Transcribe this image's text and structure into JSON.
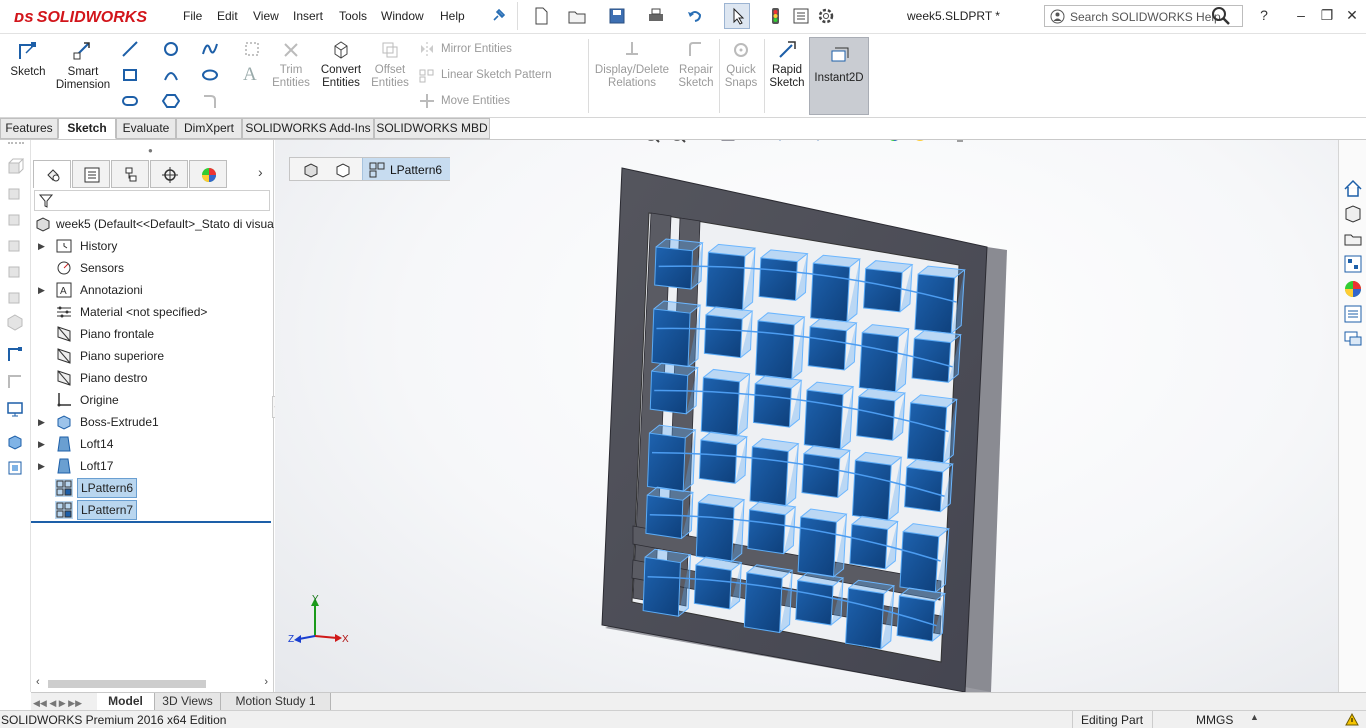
{
  "app": {
    "brand": "SOLIDWORKS",
    "document_title": "week5.SLDPRT *",
    "menu": [
      "File",
      "Edit",
      "View",
      "Insert",
      "Tools",
      "Window",
      "Help"
    ],
    "search_placeholder": "Search SOLIDWORKS Help"
  },
  "commands": {
    "sketch": "Sketch",
    "smart_dimension": "Smart Dimension",
    "trim_entities": "Trim Entities",
    "convert_entities": "Convert Entities",
    "offset_entities": "Offset Entities",
    "mirror_entities": "Mirror Entities",
    "linear_sketch_pattern": "Linear Sketch Pattern",
    "move_entities": "Move Entities",
    "display_delete_relations": "Display/Delete Relations",
    "repair_sketch": "Repair Sketch",
    "quick_snaps": "Quick Snaps",
    "rapid_sketch": "Rapid Sketch",
    "instant2d": "Instant2D"
  },
  "tabs": [
    "Features",
    "Sketch",
    "Evaluate",
    "DimXpert",
    "SOLIDWORKS Add-Ins",
    "SOLIDWORKS MBD"
  ],
  "active_tab": "Sketch",
  "feature_tree": {
    "root": "week5  (Default<<Default>_Stato di visua",
    "items": [
      {
        "label": "History",
        "expandable": true,
        "icon": "history-icon"
      },
      {
        "label": "Sensors",
        "expandable": false,
        "icon": "sensors-icon"
      },
      {
        "label": "Annotazioni",
        "expandable": true,
        "icon": "annotations-icon"
      },
      {
        "label": "Material <not specified>",
        "expandable": false,
        "icon": "material-icon"
      },
      {
        "label": "Piano frontale",
        "expandable": false,
        "icon": "plane-icon"
      },
      {
        "label": "Piano superiore",
        "expandable": false,
        "icon": "plane-icon"
      },
      {
        "label": "Piano destro",
        "expandable": false,
        "icon": "plane-icon"
      },
      {
        "label": "Origine",
        "expandable": false,
        "icon": "origin-icon"
      },
      {
        "label": "Boss-Extrude1",
        "expandable": true,
        "icon": "extrude-icon"
      },
      {
        "label": "Loft14",
        "expandable": true,
        "icon": "loft-icon"
      },
      {
        "label": "Loft17",
        "expandable": true,
        "icon": "loft-icon"
      },
      {
        "label": "LPattern6",
        "expandable": false,
        "icon": "linear-pattern-icon",
        "selected": true
      },
      {
        "label": "LPattern7",
        "expandable": false,
        "icon": "linear-pattern-icon",
        "selected": true
      }
    ]
  },
  "breadcrumb": {
    "selected": "LPattern6"
  },
  "bottom_tabs": [
    "Model",
    "3D Views",
    "Motion Study 1"
  ],
  "active_bottom_tab": "Model",
  "status": {
    "edition": "SOLIDWORKS Premium 2016 x64 Edition",
    "mode": "Editing Part",
    "units": "MMGS"
  },
  "triad": {
    "x": "X",
    "y": "Y",
    "z": "Z"
  },
  "colors": {
    "accent_blue": "#1d5fa8",
    "selection_blue": "#b9d6ef",
    "brand_red": "#d2151b",
    "frame_gray": "#505058"
  }
}
